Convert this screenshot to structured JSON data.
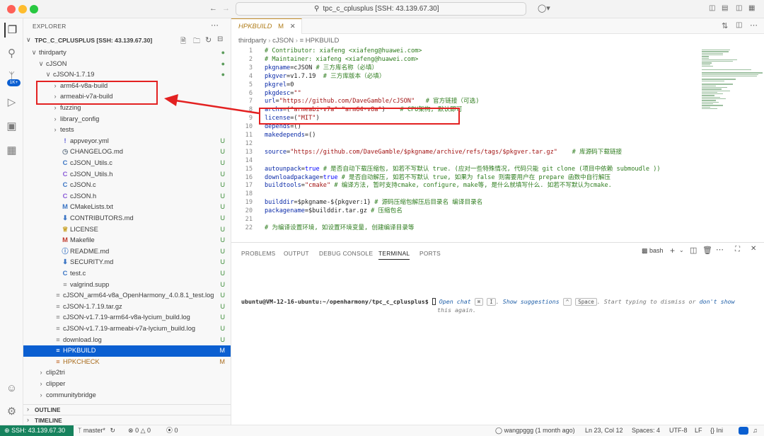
{
  "titlebar": {
    "title": "tpc_c_cplusplus [SSH: 43.139.67.30]"
  },
  "explorer": {
    "header": "EXPLORER",
    "root": "TPC_C_CPLUSPLUS [SSH: 43.139.67.30]",
    "tree": [
      {
        "label": "thirdparty",
        "chev": "∨",
        "status": "●",
        "status_color": "#5a9b5a",
        "indent": 0
      },
      {
        "label": "cJSON",
        "chev": "∨",
        "status": "●",
        "status_color": "#5a9b5a",
        "indent": 1
      },
      {
        "label": "cJSON-1.7.19",
        "chev": "∨",
        "status": "●",
        "status_color": "#5a9b5a",
        "indent": 2
      },
      {
        "label": "arm64-v8a-build",
        "chev": "›",
        "status": "",
        "indent": 3
      },
      {
        "label": "armeabi-v7a-build",
        "chev": "›",
        "status": "",
        "indent": 3
      },
      {
        "label": "fuzzing",
        "chev": "›",
        "status": "",
        "indent": 3
      },
      {
        "label": "library_config",
        "chev": "›",
        "status": "",
        "indent": 3
      },
      {
        "label": "tests",
        "chev": "›",
        "status": "",
        "indent": 3
      },
      {
        "label": "appveyor.yml",
        "icon": "!",
        "icon_color": "#5b5bd8",
        "status": "U",
        "status_color": "#388a34",
        "indent": 3
      },
      {
        "label": "CHANGELOG.md",
        "icon": "◷",
        "icon_color": "#6a7a8a",
        "status": "U",
        "status_color": "#388a34",
        "indent": 3
      },
      {
        "label": "cJSON_Utils.c",
        "icon": "C",
        "icon_color": "#3b75c4",
        "status": "U",
        "status_color": "#388a34",
        "indent": 3
      },
      {
        "label": "cJSON_Utils.h",
        "icon": "C",
        "icon_color": "#8a5bd8",
        "status": "U",
        "status_color": "#388a34",
        "indent": 3
      },
      {
        "label": "cJSON.c",
        "icon": "C",
        "icon_color": "#3b75c4",
        "status": "U",
        "status_color": "#388a34",
        "indent": 3
      },
      {
        "label": "cJSON.h",
        "icon": "C",
        "icon_color": "#8a5bd8",
        "status": "U",
        "status_color": "#388a34",
        "indent": 3
      },
      {
        "label": "CMakeLists.txt",
        "icon": "M",
        "icon_color": "#3b75c4",
        "status": "U",
        "status_color": "#388a34",
        "indent": 3
      },
      {
        "label": "CONTRIBUTORS.md",
        "icon": "⬇",
        "icon_color": "#3b75c4",
        "status": "U",
        "status_color": "#388a34",
        "indent": 3
      },
      {
        "label": "LICENSE",
        "icon": "♕",
        "icon_color": "#c9a227",
        "status": "U",
        "status_color": "#388a34",
        "indent": 3
      },
      {
        "label": "Makefile",
        "icon": "M",
        "icon_color": "#c0392b",
        "status": "U",
        "status_color": "#388a34",
        "indent": 3
      },
      {
        "label": "README.md",
        "icon": "ⓘ",
        "icon_color": "#3b75c4",
        "status": "U",
        "status_color": "#388a34",
        "indent": 3
      },
      {
        "label": "SECURITY.md",
        "icon": "⬇",
        "icon_color": "#3b75c4",
        "status": "U",
        "status_color": "#388a34",
        "indent": 3
      },
      {
        "label": "test.c",
        "icon": "C",
        "icon_color": "#3b75c4",
        "status": "U",
        "status_color": "#388a34",
        "indent": 3
      },
      {
        "label": "valgrind.supp",
        "icon": "≡",
        "icon_color": "#8a8a8a",
        "status": "U",
        "status_color": "#388a34",
        "indent": 3
      },
      {
        "label": "cJSON_arm64-v8a_OpenHarmony_4.0.8.1_test.log",
        "icon": "≡",
        "icon_color": "#8a8a8a",
        "status": "U",
        "status_color": "#388a34",
        "indent": 2
      },
      {
        "label": "cJSON-1.7.19.tar.gz",
        "icon": "≡",
        "icon_color": "#8a8a8a",
        "status": "U",
        "status_color": "#388a34",
        "indent": 2
      },
      {
        "label": "cJSON-v1.7.19-arm64-v8a-lycium_build.log",
        "icon": "≡",
        "icon_color": "#8a8a8a",
        "status": "U",
        "status_color": "#388a34",
        "indent": 2
      },
      {
        "label": "cJSON-v1.7.19-armeabi-v7a-lycium_build.log",
        "icon": "≡",
        "icon_color": "#8a8a8a",
        "status": "U",
        "status_color": "#388a34",
        "indent": 2
      },
      {
        "label": "download.log",
        "icon": "≡",
        "icon_color": "#8a8a8a",
        "status": "U",
        "status_color": "#388a34",
        "indent": 2
      },
      {
        "label": "HPKBUILD",
        "icon": "≡",
        "icon_color": "#ffffff",
        "status": "M",
        "status_color": "#ffffff",
        "indent": 2,
        "selected": true
      },
      {
        "label": "HPKCHECK",
        "icon": "≡",
        "icon_color": "#c26a2a",
        "status": "M",
        "status_color": "#a86b1c",
        "indent": 2,
        "label_color": "#a86b1c"
      },
      {
        "label": "clip2tri",
        "chev": "›",
        "status": "",
        "indent": 1
      },
      {
        "label": "clipper",
        "chev": "›",
        "status": "",
        "indent": 1
      },
      {
        "label": "communitybridge",
        "chev": "›",
        "status": "",
        "indent": 1
      }
    ],
    "outline": "OUTLINE",
    "timeline": "TIMELINE"
  },
  "editor": {
    "tab_label": "HPKBUILD",
    "tab_status": "M",
    "breadcrumbs": [
      "thirdparty",
      "cJSON",
      "HPKBUILD"
    ],
    "lines": [
      {
        "n": "1",
        "parts": [
          {
            "t": "# Contributor: xiafeng <xiafeng@huawei.com>",
            "c": "cm"
          }
        ]
      },
      {
        "n": "2",
        "parts": [
          {
            "t": "# Maintainer: xiafeng <xiafeng@huawei.com>",
            "c": "cm"
          }
        ]
      },
      {
        "n": "3",
        "parts": [
          {
            "t": "pkgname",
            "c": "var"
          },
          {
            "t": "=cJSON "
          },
          {
            "t": "# 三方库名称（必填）",
            "c": "cm"
          }
        ]
      },
      {
        "n": "4",
        "parts": [
          {
            "t": "pkgver",
            "c": "var"
          },
          {
            "t": "=v1.7.19  "
          },
          {
            "t": "# 三方库版本（必填）",
            "c": "cm"
          }
        ]
      },
      {
        "n": "5",
        "parts": [
          {
            "t": "pkgrel",
            "c": "var"
          },
          {
            "t": "=0"
          }
        ]
      },
      {
        "n": "6",
        "parts": [
          {
            "t": "pkgdesc",
            "c": "var"
          },
          {
            "t": "="
          },
          {
            "t": "\"\"",
            "c": "str"
          }
        ]
      },
      {
        "n": "7",
        "parts": [
          {
            "t": "url",
            "c": "var"
          },
          {
            "t": "="
          },
          {
            "t": "\"https://github.com/DaveGamble/cJSON\"",
            "c": "str"
          },
          {
            "t": "   "
          },
          {
            "t": "# 官方链接（可选)",
            "c": "cm"
          }
        ]
      },
      {
        "n": "8",
        "parts": [
          {
            "t": "archs",
            "c": "var"
          },
          {
            "t": "=("
          },
          {
            "t": "\"armeabi-v7a\"",
            "c": "str"
          },
          {
            "t": " "
          },
          {
            "t": "\"arm64-v8a\"",
            "c": "str"
          },
          {
            "t": ")    "
          },
          {
            "t": "# CPU架构, 默认即可",
            "c": "cm"
          }
        ]
      },
      {
        "n": "9",
        "parts": [
          {
            "t": "license",
            "c": "var"
          },
          {
            "t": "=("
          },
          {
            "t": "\"MIT\"",
            "c": "str"
          },
          {
            "t": ")"
          }
        ]
      },
      {
        "n": "10",
        "parts": [
          {
            "t": "depends",
            "c": "var"
          },
          {
            "t": "=()"
          }
        ]
      },
      {
        "n": "11",
        "parts": [
          {
            "t": "makedepends",
            "c": "var"
          },
          {
            "t": "=()"
          }
        ]
      },
      {
        "n": "12",
        "parts": []
      },
      {
        "n": "13",
        "parts": [
          {
            "t": "source",
            "c": "var"
          },
          {
            "t": "="
          },
          {
            "t": "\"https://github.com/DaveGamble/$pkgname/archive/refs/tags/$pkgver.tar.gz\"",
            "c": "str"
          },
          {
            "t": "    "
          },
          {
            "t": "# 库源码下载链接",
            "c": "cm"
          }
        ]
      },
      {
        "n": "14",
        "parts": []
      },
      {
        "n": "15",
        "parts": [
          {
            "t": "autounpack",
            "c": "var"
          },
          {
            "t": "="
          },
          {
            "t": "true",
            "c": "kw"
          },
          {
            "t": " "
          },
          {
            "t": "# 是否自动下载压缩包, 如若不写默认 true. (应对一些特殊情况, 代码只能 git clone (项目中依赖 submoudle ))",
            "c": "cm"
          }
        ]
      },
      {
        "n": "16",
        "parts": [
          {
            "t": "downloadpackage",
            "c": "var"
          },
          {
            "t": "="
          },
          {
            "t": "true",
            "c": "kw"
          },
          {
            "t": " "
          },
          {
            "t": "# 是否自动解压, 如若不写默认 true, 如果为 false 则需要用户在 prepare 函数中自行解压",
            "c": "cm"
          }
        ]
      },
      {
        "n": "17",
        "parts": [
          {
            "t": "buildtools",
            "c": "var"
          },
          {
            "t": "="
          },
          {
            "t": "\"cmake\"",
            "c": "str"
          },
          {
            "t": " "
          },
          {
            "t": "# 编译方法, 暂时支持cmake, configure, make等, 是什么就填写什么. 如若不写默认为cmake.",
            "c": "cm"
          }
        ]
      },
      {
        "n": "18",
        "parts": []
      },
      {
        "n": "19",
        "parts": [
          {
            "t": "builddir",
            "c": "var"
          },
          {
            "t": "=$pkgname-${pkgver:1} "
          },
          {
            "t": "# 源码压缩包解压后目录名 编译目录名",
            "c": "cm"
          }
        ]
      },
      {
        "n": "20",
        "parts": [
          {
            "t": "packagename",
            "c": "var"
          },
          {
            "t": "=$builddir.tar.gz "
          },
          {
            "t": "# 压缩包名",
            "c": "cm"
          }
        ]
      },
      {
        "n": "21",
        "parts": []
      },
      {
        "n": "22",
        "parts": [
          {
            "t": "# 为编译设置环境, 如设置环境变量, 创建编译目录等",
            "c": "cm"
          }
        ]
      }
    ]
  },
  "panel": {
    "tabs": [
      "PROBLEMS",
      "OUTPUT",
      "DEBUG CONSOLE",
      "TERMINAL",
      "PORTS"
    ],
    "active_tab": "TERMINAL",
    "shell": "bash",
    "prompt": "ubuntu@VM-12-16-ubuntu:~/openharmony/tpc_c_cplusplus$",
    "hint": {
      "open_chat": "Open chat",
      "key1": "⌘",
      "key2": "I",
      "show_suggestions": "Show suggestions",
      "key3": "^",
      "key4": "Space",
      "middle": ". Start typing to dismiss or",
      "dont_show": "don't show",
      "line2": "this again."
    }
  },
  "statusbar": {
    "remote": "SSH: 43.139.67.30",
    "branch": "master*",
    "errors": "0",
    "warnings": "0",
    "ports": "0",
    "blame": "wangpggg (1 month ago)",
    "position": "Ln 23, Col 12",
    "spaces": "Spaces: 4",
    "encoding": "UTF-8",
    "eol": "LF",
    "language": "{} Ini"
  },
  "colors": {
    "accent": "#0b5fd1",
    "remote": "#16825d",
    "annotation": "#e32121"
  }
}
